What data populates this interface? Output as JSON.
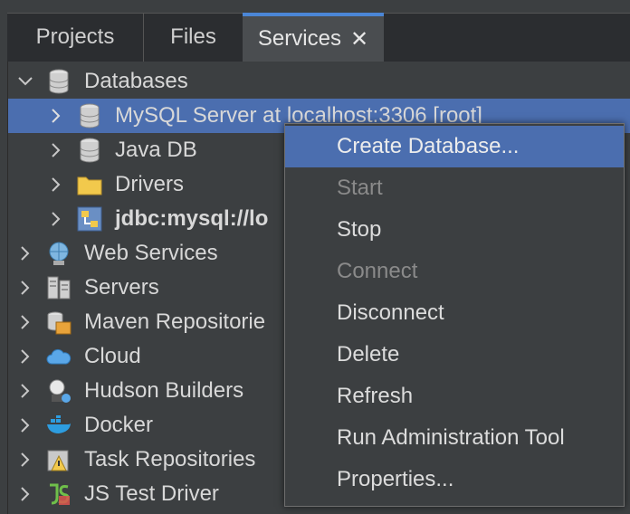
{
  "tabs": [
    {
      "label": "Projects"
    },
    {
      "label": "Files"
    },
    {
      "label": "Services",
      "active": true
    }
  ],
  "close_glyph": "✕",
  "tree": {
    "databases": {
      "label": "Databases",
      "icon": "database-icon"
    },
    "db_children": [
      {
        "label": "MySQL Server at localhost:3306 [root]",
        "icon": "database-icon",
        "selected": true
      },
      {
        "label": "Java DB",
        "icon": "database-icon"
      },
      {
        "label": "Drivers",
        "icon": "folder-icon"
      },
      {
        "label": "jdbc:mysql://lo",
        "icon": "connection-icon",
        "bold": true
      }
    ],
    "nodes": [
      {
        "label": "Web Services",
        "icon": "web-services-icon"
      },
      {
        "label": "Servers",
        "icon": "servers-icon"
      },
      {
        "label": "Maven Repositorie",
        "icon": "maven-icon"
      },
      {
        "label": "Cloud",
        "icon": "cloud-icon"
      },
      {
        "label": "Hudson Builders",
        "icon": "hudson-icon"
      },
      {
        "label": "Docker",
        "icon": "docker-icon"
      },
      {
        "label": "Task Repositories",
        "icon": "task-repo-icon"
      },
      {
        "label": "JS Test Driver",
        "icon": "js-test-icon"
      }
    ]
  },
  "context_menu": {
    "items": [
      {
        "label": "Create Database...",
        "highlighted": true
      },
      {
        "label": "Start",
        "disabled": true
      },
      {
        "label": "Stop"
      },
      {
        "label": "Connect",
        "disabled": true
      },
      {
        "label": "Disconnect"
      },
      {
        "label": "Delete"
      },
      {
        "label": "Refresh"
      },
      {
        "label": "Run Administration Tool"
      },
      {
        "label": "Properties..."
      }
    ]
  },
  "colors": {
    "selection": "#4b6eaf",
    "tab_accent": "#4b86d6",
    "background": "#3c3f41"
  }
}
